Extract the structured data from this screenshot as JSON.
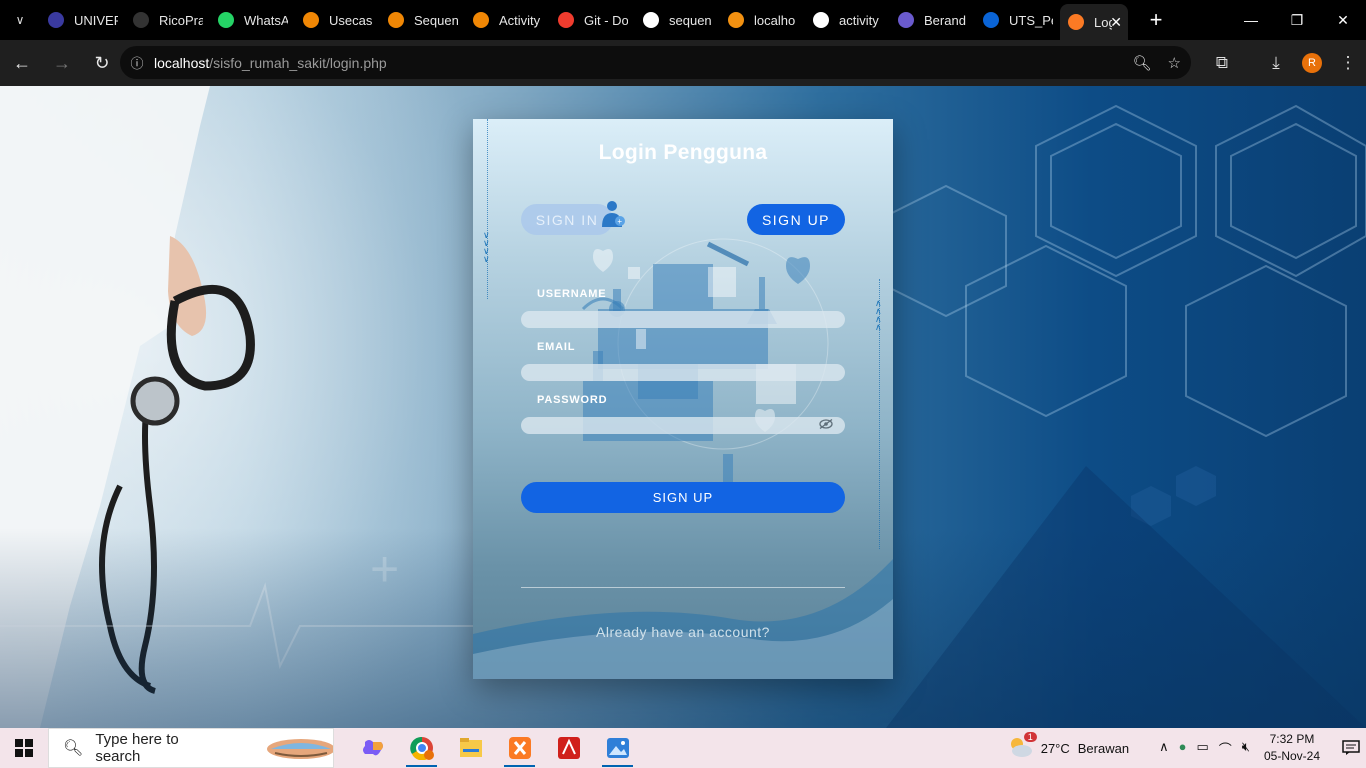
{
  "browser": {
    "tabs": [
      {
        "label": "UNIVER",
        "icon": "university-icon",
        "color": "#3a3aa0"
      },
      {
        "label": "RicoPra",
        "icon": "github-icon",
        "color": "#333"
      },
      {
        "label": "WhatsA",
        "icon": "whatsapp-icon",
        "color": "#25d366"
      },
      {
        "label": "Usecas",
        "icon": "drawio-icon",
        "color": "#f08705"
      },
      {
        "label": "Sequen",
        "icon": "drawio-icon",
        "color": "#f08705"
      },
      {
        "label": "Activity",
        "icon": "drawio-icon",
        "color": "#f08705"
      },
      {
        "label": "Git - Do",
        "icon": "git-icon",
        "color": "#f03c2e"
      },
      {
        "label": "sequen",
        "icon": "google-icon",
        "color": "#fff"
      },
      {
        "label": "localho",
        "icon": "phpmyadmin-icon",
        "color": "#f29111"
      },
      {
        "label": "activity",
        "icon": "google-icon",
        "color": "#fff"
      },
      {
        "label": "Berand",
        "icon": "lms-icon",
        "color": "#6a5acd"
      },
      {
        "label": "UTS_Pe",
        "icon": "onedrive-icon",
        "color": "#0a64d6"
      },
      {
        "label": "Log",
        "icon": "xampp-icon",
        "color": "#fb7a24"
      }
    ],
    "url_host": "localhost",
    "url_path": "/sisfo_rumah_sakit/login.php",
    "profile_initial": "R"
  },
  "login": {
    "title": "Login Pengguna",
    "signin_tab": "SIGN IN",
    "signup_tab": "SIGN UP",
    "username_label": "USERNAME",
    "email_label": "EMAIL",
    "password_label": "PASSWORD",
    "username_value": "",
    "email_value": "",
    "password_value": "",
    "submit_label": "SIGN UP",
    "footer_text": "Already have an account?"
  },
  "taskbar": {
    "search_placeholder": "Type here to search",
    "weather_temp": "27°C",
    "weather_text": "Berawan",
    "weather_badge": "1",
    "time": "7:32 PM",
    "date": "05-Nov-24"
  }
}
